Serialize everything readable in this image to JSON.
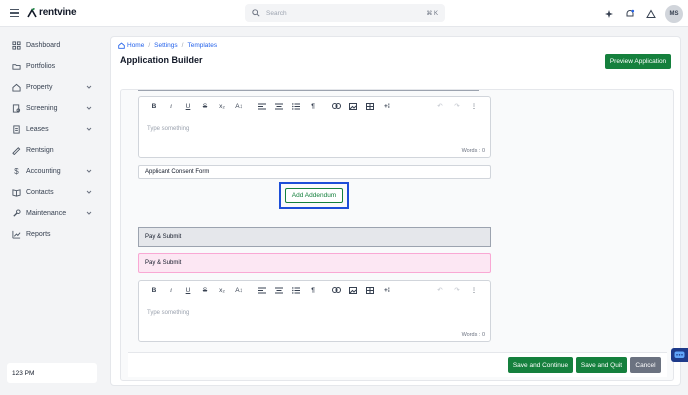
{
  "brand": {
    "name": "rentvine",
    "color": "#15803d"
  },
  "search": {
    "placeholder": "Search",
    "shortcut": "⌘ K"
  },
  "user": {
    "initials": "MS"
  },
  "top_icons": [
    "sparkle-icon",
    "bell-icon",
    "alert-triangle-icon"
  ],
  "sidebar": {
    "items": [
      {
        "label": "Dashboard",
        "icon": "grid-icon",
        "expandable": false
      },
      {
        "label": "Portfolios",
        "icon": "folder-icon",
        "expandable": false
      },
      {
        "label": "Property",
        "icon": "house-icon",
        "expandable": true
      },
      {
        "label": "Screening",
        "icon": "screening-icon",
        "expandable": true
      },
      {
        "label": "Leases",
        "icon": "lease-icon",
        "expandable": true
      },
      {
        "label": "Rentsign",
        "icon": "signature-icon",
        "expandable": false
      },
      {
        "label": "Accounting",
        "icon": "dollar-icon",
        "expandable": true
      },
      {
        "label": "Contacts",
        "icon": "book-icon",
        "expandable": true
      },
      {
        "label": "Maintenance",
        "icon": "wrench-icon",
        "expandable": true
      },
      {
        "label": "Reports",
        "icon": "chart-icon",
        "expandable": false
      }
    ],
    "time": "123 PM"
  },
  "breadcrumb": [
    "Home",
    "Settings",
    "Templates"
  ],
  "page": {
    "title": "Application Builder",
    "preview_button": "Preview Application"
  },
  "editor_toolbar": [
    "B",
    "i",
    "U",
    "S",
    "x₂",
    "A↕"
  ],
  "editors": [
    {
      "placeholder": "Type something",
      "word_count": "Words : 0"
    },
    {
      "placeholder": "Type something",
      "word_count": "Words : 0"
    }
  ],
  "fields": {
    "consent_form": "Applicant Consent Form"
  },
  "addendum_button": "Add Addendum",
  "sections": {
    "pay_submit_gray": "Pay & Submit",
    "pay_submit_pink": "Pay & Submit"
  },
  "footer_buttons": {
    "save_continue": "Save and Continue",
    "save_quit": "Save and Quit",
    "cancel": "Cancel"
  },
  "colors": {
    "accent_green": "#15803d",
    "highlight_blue": "#1d4ed8",
    "pink_section": "#fce7f3",
    "cancel_gray": "#6b7280"
  }
}
